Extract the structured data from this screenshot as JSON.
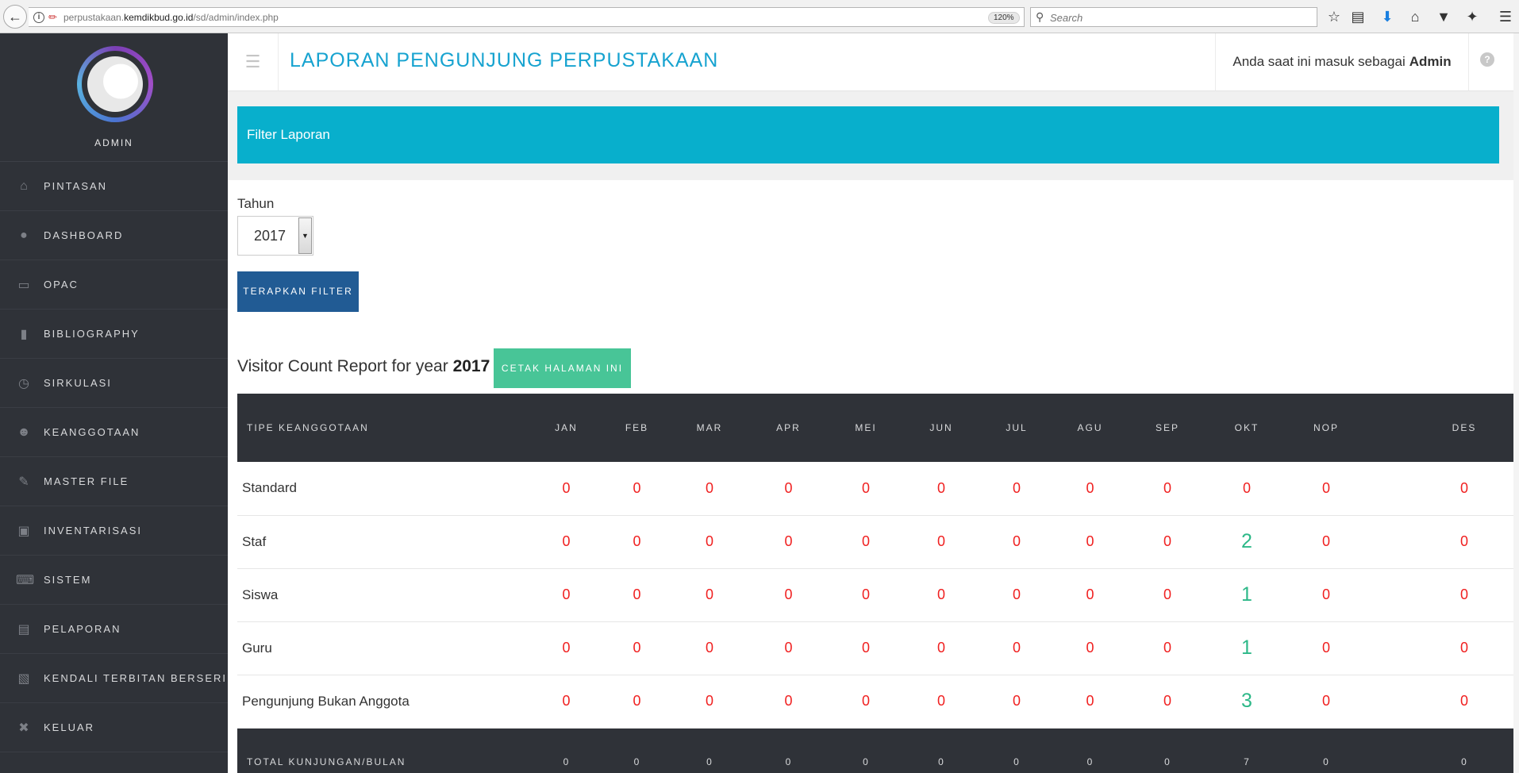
{
  "browser": {
    "url_prefix": "perpustakaan.",
    "url_domain": "kemdikbud.go.id",
    "url_path": "/sd/admin/index.php",
    "zoom": "120%",
    "search_placeholder": "Search"
  },
  "sidebar": {
    "profile_name": "ADMIN",
    "items": [
      {
        "label": "PINTASAN",
        "icon": "home-icon"
      },
      {
        "label": "DASHBOARD",
        "icon": "dashboard-icon"
      },
      {
        "label": "OPAC",
        "icon": "monitor-icon"
      },
      {
        "label": "BIBLIOGRAPHY",
        "icon": "bookmark-icon"
      },
      {
        "label": "SIRKULASI",
        "icon": "clock-icon"
      },
      {
        "label": "KEANGGOTAAN",
        "icon": "user-icon"
      },
      {
        "label": "MASTER FILE",
        "icon": "pencil-icon"
      },
      {
        "label": "INVENTARISASI",
        "icon": "briefcase-icon"
      },
      {
        "label": "SISTEM",
        "icon": "keyboard-icon"
      },
      {
        "label": "PELAPORAN",
        "icon": "document-icon"
      },
      {
        "label": "KENDALI TERBITAN BERSERI",
        "icon": "film-icon"
      },
      {
        "label": "KELUAR",
        "icon": "close-icon"
      }
    ]
  },
  "header": {
    "title": "LAPORAN PENGUNJUNG PERPUSTAKAAN",
    "user_text": "Anda saat ini masuk sebagai",
    "user_name": "Admin"
  },
  "filter": {
    "bar_title": "Filter Laporan",
    "year_label": "Tahun",
    "year_value": "2017",
    "apply_label": "TERAPKAN FILTER"
  },
  "report": {
    "heading_text": "Visitor Count Report for year",
    "heading_year": "2017",
    "print_label": "CETAK HALAMAN INI",
    "type_header": "TIPE KEANGGOTAAN",
    "months": [
      "JAN",
      "FEB",
      "MAR",
      "APR",
      "MEI",
      "JUN",
      "JUL",
      "AGU",
      "SEP",
      "OKT",
      "NOP",
      "DES"
    ],
    "rows": [
      {
        "type": "Standard",
        "values": [
          0,
          0,
          0,
          0,
          0,
          0,
          0,
          0,
          0,
          0,
          0,
          0
        ]
      },
      {
        "type": "Staf",
        "values": [
          0,
          0,
          0,
          0,
          0,
          0,
          0,
          0,
          0,
          2,
          0,
          0
        ]
      },
      {
        "type": "Siswa",
        "values": [
          0,
          0,
          0,
          0,
          0,
          0,
          0,
          0,
          0,
          1,
          0,
          0
        ]
      },
      {
        "type": "Guru",
        "values": [
          0,
          0,
          0,
          0,
          0,
          0,
          0,
          0,
          0,
          1,
          0,
          0
        ]
      },
      {
        "type": "Pengunjung Bukan Anggota",
        "values": [
          0,
          0,
          0,
          0,
          0,
          0,
          0,
          0,
          0,
          3,
          0,
          0
        ]
      }
    ],
    "total_label": "TOTAL KUNJUNGAN/BULAN",
    "totals": [
      0,
      0,
      0,
      0,
      0,
      0,
      0,
      0,
      0,
      7,
      0,
      0
    ]
  },
  "colors": {
    "accent": "#08afcc",
    "title": "#17a3d0",
    "sidebar": "#2f3238",
    "apply_button": "#215b94",
    "print_button": "#48c597",
    "zero_value": "#f01f1f",
    "positive_value": "#2db888"
  }
}
